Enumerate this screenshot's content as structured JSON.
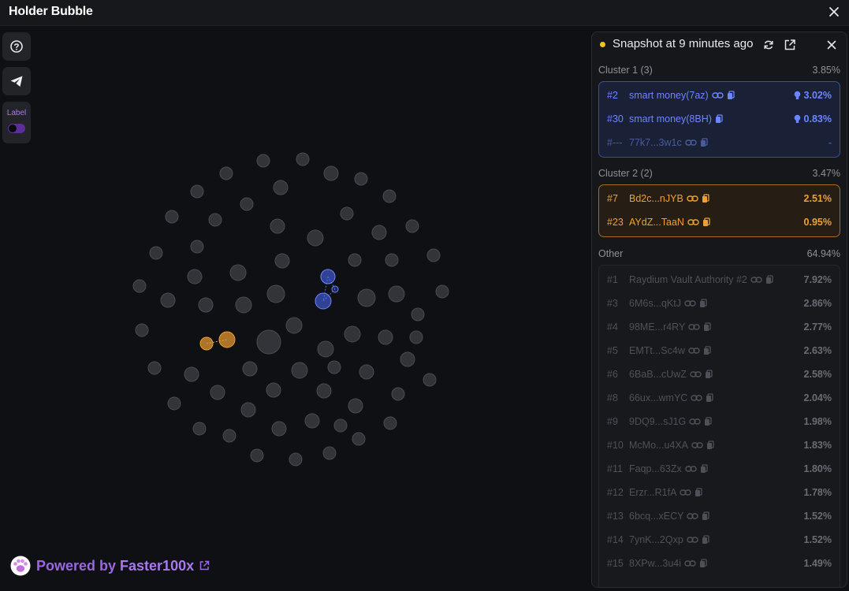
{
  "window": {
    "title": "Holder Bubble"
  },
  "toolbar": {
    "label_toggle_text": "Label"
  },
  "footer": {
    "powered_text": "Powered by",
    "brand": "Faster100x"
  },
  "panel": {
    "snapshot_text": "Snapshot at 9 minutes ago",
    "clusters": [
      {
        "title": "Cluster 1 (3)",
        "percent": "3.85%",
        "rows": [
          {
            "rank": "#2",
            "name": "smart money(7az)",
            "percent": "3.02%"
          },
          {
            "rank": "#30",
            "name": "smart money(8BH)",
            "percent": "0.83%"
          },
          {
            "rank": "#---",
            "name": "77k7...3w1c",
            "percent": "-"
          }
        ]
      },
      {
        "title": "Cluster 2 (2)",
        "percent": "3.47%",
        "rows": [
          {
            "rank": "#7",
            "name": "Bd2c...nJYB",
            "percent": "2.51%"
          },
          {
            "rank": "#23",
            "name": "AYdZ...TaaN",
            "percent": "0.95%"
          }
        ]
      }
    ],
    "other": {
      "title": "Other",
      "percent": "64.94%",
      "rows": [
        {
          "rank": "#1",
          "name": "Raydium Vault Authority #2",
          "percent": "7.92%"
        },
        {
          "rank": "#3",
          "name": "6M6s...qKtJ",
          "percent": "2.86%"
        },
        {
          "rank": "#4",
          "name": "98ME...r4RY",
          "percent": "2.77%"
        },
        {
          "rank": "#5",
          "name": "EMTt...Sc4w",
          "percent": "2.63%"
        },
        {
          "rank": "#6",
          "name": "6BaB...cUwZ",
          "percent": "2.58%"
        },
        {
          "rank": "#8",
          "name": "66ux...wmYC",
          "percent": "2.04%"
        },
        {
          "rank": "#9",
          "name": "9DQ9...sJ1G",
          "percent": "1.98%"
        },
        {
          "rank": "#10",
          "name": "McMo...u4XA",
          "percent": "1.83%"
        },
        {
          "rank": "#11",
          "name": "Faqp...63Zx",
          "percent": "1.80%"
        },
        {
          "rank": "#12",
          "name": "Erzr...R1fA",
          "percent": "1.78%"
        },
        {
          "rank": "#13",
          "name": "6bcq...xECY",
          "percent": "1.52%"
        },
        {
          "rank": "#14",
          "name": "7ynK...2Qxp",
          "percent": "1.52%"
        },
        {
          "rank": "#15",
          "name": "8XPw...3u4i",
          "percent": "1.49%"
        }
      ]
    }
  },
  "colors": {
    "cluster1": "#4f6bff",
    "cluster2": "#f0a030",
    "other": "#3a3b40",
    "accent": "#9b67e0",
    "snapshot_dot": "#f0c419"
  }
}
